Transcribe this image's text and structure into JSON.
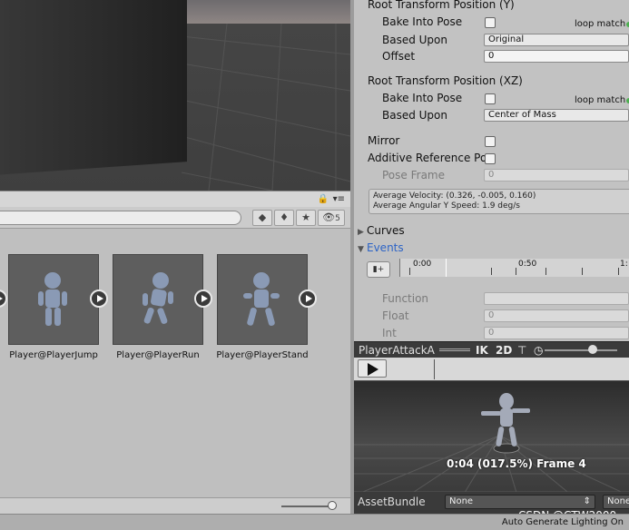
{
  "inspector": {
    "root_y": {
      "header": "Root Transform Position (Y)",
      "bake_label": "Bake Into Pose",
      "loop_match": "loop match",
      "based_upon_label": "Based Upon",
      "based_upon_value": "Original",
      "offset_label": "Offset",
      "offset_value": "0"
    },
    "root_xz": {
      "header": "Root Transform Position (XZ)",
      "bake_label": "Bake Into Pose",
      "loop_match": "loop match",
      "based_upon_label": "Based Upon",
      "based_upon_value": "Center of Mass"
    },
    "mirror_label": "Mirror",
    "additive_label": "Additive Reference Po",
    "pose_frame_label": "Pose Frame",
    "pose_frame_value": "0",
    "average_velocity": "Average Velocity: (0.326, -0.005, 0.160)",
    "average_angular": "Average Angular Y Speed: 1.9 deg/s",
    "curves_label": "Curves",
    "events_label": "Events",
    "timeline_ticks": [
      "0:00",
      "0:50",
      "1:"
    ],
    "function_label": "Function",
    "float_label": "Float",
    "float_value": "0",
    "int_label": "Int",
    "int_value": "0"
  },
  "preview": {
    "title": "PlayerAttackA",
    "ik_label": "IK",
    "twod_label": "2D",
    "frame_text": "0:04 (017.5%) Frame 4"
  },
  "assetbundle": {
    "label": "AssetBundle",
    "value1": "None",
    "value2": "None"
  },
  "project": {
    "assets": [
      {
        "name": "Player@PlayerJump"
      },
      {
        "name": "Player@PlayerRun"
      },
      {
        "name": "Player@PlayerStand"
      }
    ],
    "filter_count": "5"
  },
  "watermark": "CSDN @CTW2000",
  "status_text": "Auto Generate Lighting On"
}
